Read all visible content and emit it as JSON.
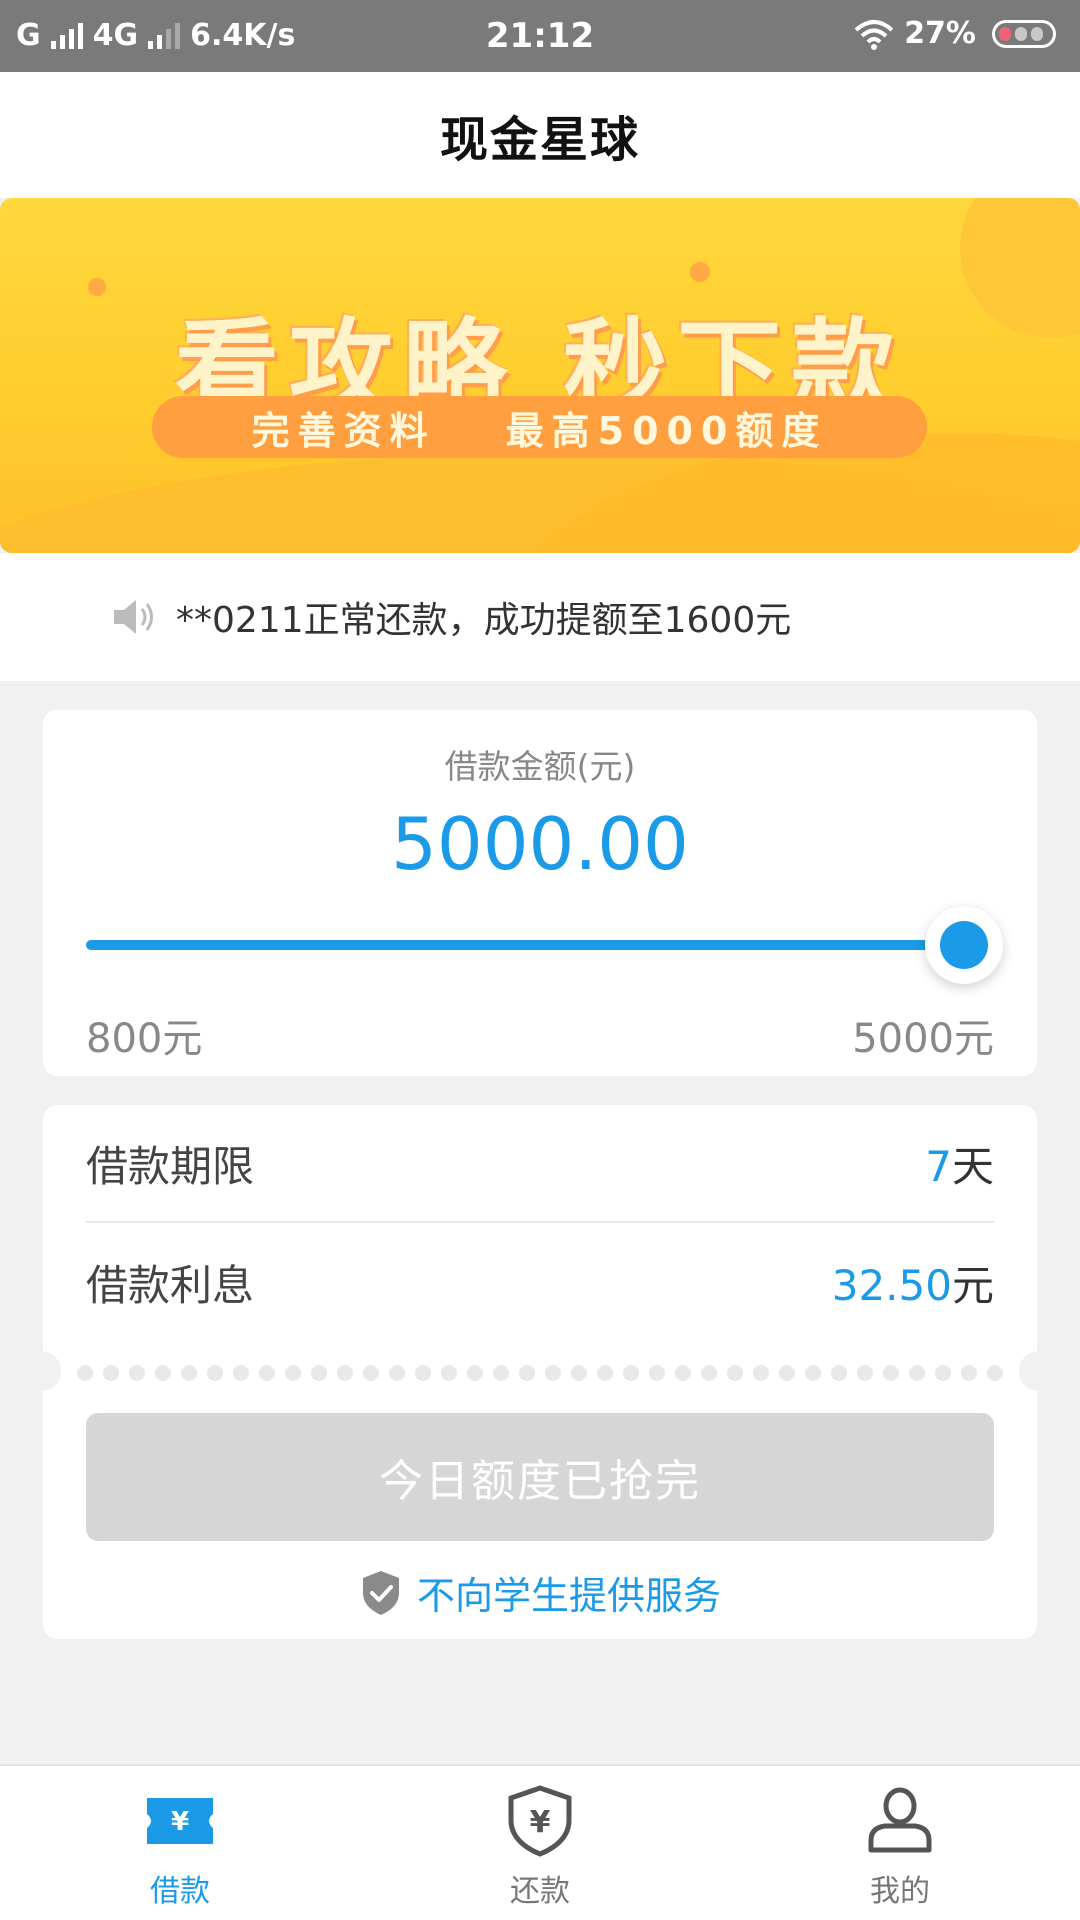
{
  "status_bar": {
    "carrier1": "G",
    "carrier2": "4G",
    "speed": "6.4K/s",
    "time": "21:12",
    "battery": "27%"
  },
  "header": {
    "title": "现金星球"
  },
  "banner": {
    "headline": "看攻略  秒下款",
    "sub_left": "完善资料",
    "sub_right": "最高5000额度"
  },
  "notice": {
    "text": "**0211正常还款，成功提额至1600元",
    "icon": "speaker-icon"
  },
  "amount_card": {
    "label": "借款金额(元)",
    "value": "5000.00",
    "min_label": "800元",
    "max_label": "5000元",
    "slider_fraction": 1.0
  },
  "details": {
    "term_label": "借款期限",
    "term_value": "7",
    "term_unit": "天",
    "interest_label": "借款利息",
    "interest_value": "32.50",
    "interest_unit": "元"
  },
  "cta": {
    "label": "今日额度已抢完",
    "disabled": true
  },
  "student_note": {
    "text": "不向学生提供服务",
    "icon": "shield-check-icon"
  },
  "bottom_nav": {
    "items": [
      {
        "label": "借款",
        "icon": "loan-ticket-icon",
        "active": true
      },
      {
        "label": "还款",
        "icon": "shield-yen-icon",
        "active": false
      },
      {
        "label": "我的",
        "icon": "person-icon",
        "active": false
      }
    ]
  },
  "colors": {
    "accent": "#1a9ae7",
    "banner": "#ffcd2e",
    "disabled": "#d6d6d6"
  }
}
